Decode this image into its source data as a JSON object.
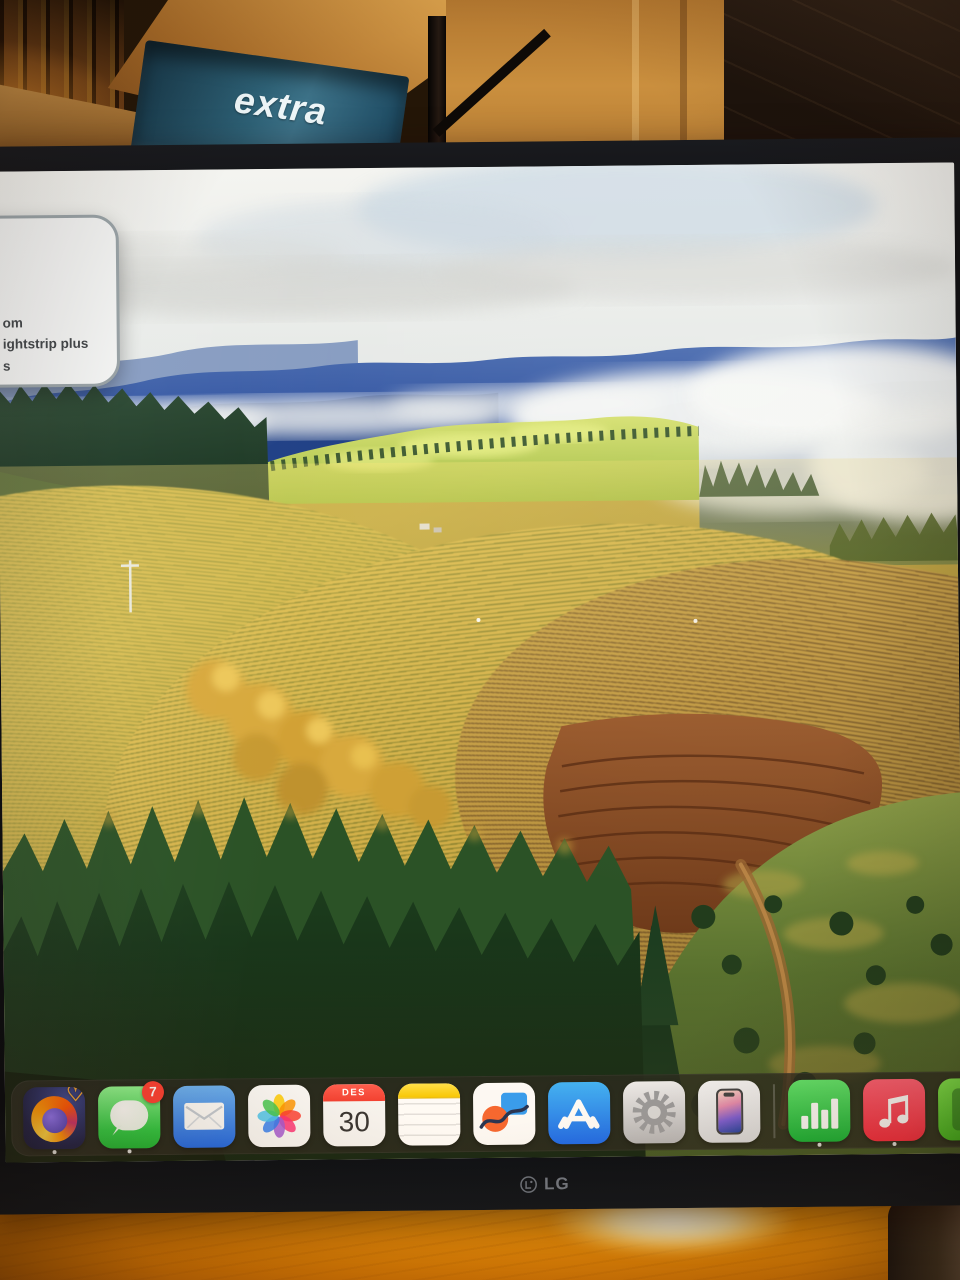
{
  "monitor": {
    "brand": "LG"
  },
  "environment": {
    "box_label": "extra"
  },
  "notification": {
    "line1": "om",
    "line2": "ightstrip plus",
    "line3": "s"
  },
  "dock": {
    "items": [
      {
        "name": "Firefox",
        "icon": "firefox-icon",
        "running": true
      },
      {
        "name": "Messages",
        "icon": "messages-icon",
        "running": true,
        "badge": "7"
      },
      {
        "name": "Mail",
        "icon": "mail-icon",
        "running": false
      },
      {
        "name": "Photos",
        "icon": "photos-icon",
        "running": false
      },
      {
        "name": "Calendar",
        "icon": "calendar-icon",
        "running": false,
        "month": "DES",
        "day": "30"
      },
      {
        "name": "Notes",
        "icon": "notes-icon",
        "running": false
      },
      {
        "name": "Freeform",
        "icon": "freeform-icon",
        "running": false
      },
      {
        "name": "App Store",
        "icon": "app-store-icon",
        "running": false
      },
      {
        "name": "System Settings",
        "icon": "settings-gear-icon",
        "running": false
      },
      {
        "name": "iPhone Mirroring",
        "icon": "iphone-mirroring-icon",
        "running": false
      },
      {
        "name": "Numbers",
        "icon": "numbers-icon",
        "running": true
      },
      {
        "name": "Music",
        "icon": "music-icon",
        "running": true
      },
      {
        "name": "Partially visible app",
        "icon": "partial-green-app-icon",
        "running": false
      }
    ]
  },
  "colors": {
    "badge_red": "#ff3b30",
    "calendar_red": "#f23b30",
    "notes_yellow": "#ffd60a",
    "messages_green": "#28c840",
    "mail_blue": "#1b66e8",
    "app_store_blue": "#1e6ff2",
    "music_red": "#f8283e",
    "numbers_green": "#18b735",
    "dock_background": "rgba(34,36,30,0.78)",
    "bezel_black": "#131417",
    "desk_orange": "#ef9109"
  }
}
